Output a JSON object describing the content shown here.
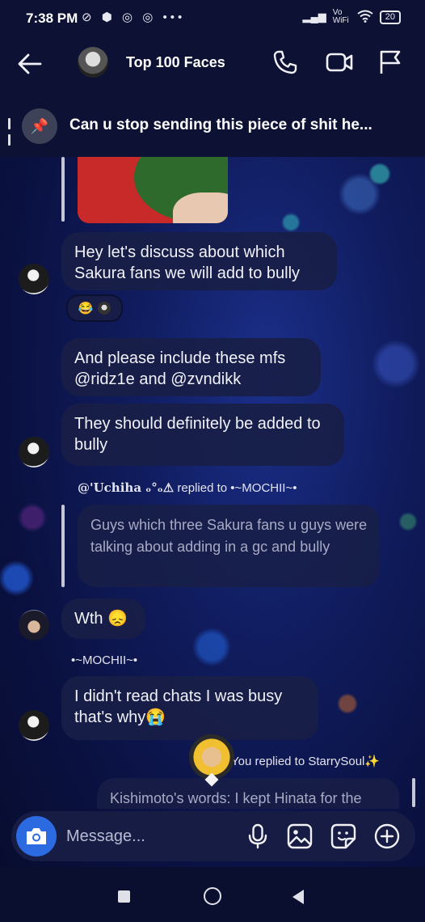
{
  "status_bar": {
    "time": "7:38 PM",
    "notification_icons": "⊘ ⬢ ◎ ◎ •••",
    "network": "Vo WiFi",
    "battery": "20"
  },
  "header": {
    "title": "Top 100 Faces"
  },
  "pinned": {
    "text": "Can u stop sending this piece of shit he..."
  },
  "messages": {
    "m1": "Hey let's discuss about which Sakura fans we will add to bully",
    "m1_reactions": "😂",
    "m2": "And please include these mfs @ridz1e and @zvndikk",
    "m3": "They should definitely be added to bully",
    "reply1_sender": "@'Uchiha ₒ°ₒ⚠",
    "reply1_label": "replied to •~MOCHII~•",
    "reply1_quote": "Guys which three Sakura fans u guys were talking about adding in a gc and bully",
    "m4": "Wth 😞",
    "m5_sender": "•~MOCHII~•",
    "m5": "I didn't read chats I was busy that's why😭",
    "reply2_label": "You replied to StarrySoul✨",
    "reply2_quote": "Kishimoto's words: I kept Hinata for the"
  },
  "composer": {
    "placeholder": "Message..."
  },
  "icons": {
    "back": "arrow-left-icon",
    "call": "phone-icon",
    "video": "video-camera-icon",
    "report": "flag-icon",
    "pin": "pin-icon",
    "camera": "camera-icon",
    "mic": "microphone-icon",
    "gallery": "image-icon",
    "sticker": "sticker-icon",
    "plus": "plus-circle-icon"
  },
  "colors": {
    "accent": "#2b6ae0",
    "bubble": "#181e46",
    "header_bg": "#0d1235"
  }
}
